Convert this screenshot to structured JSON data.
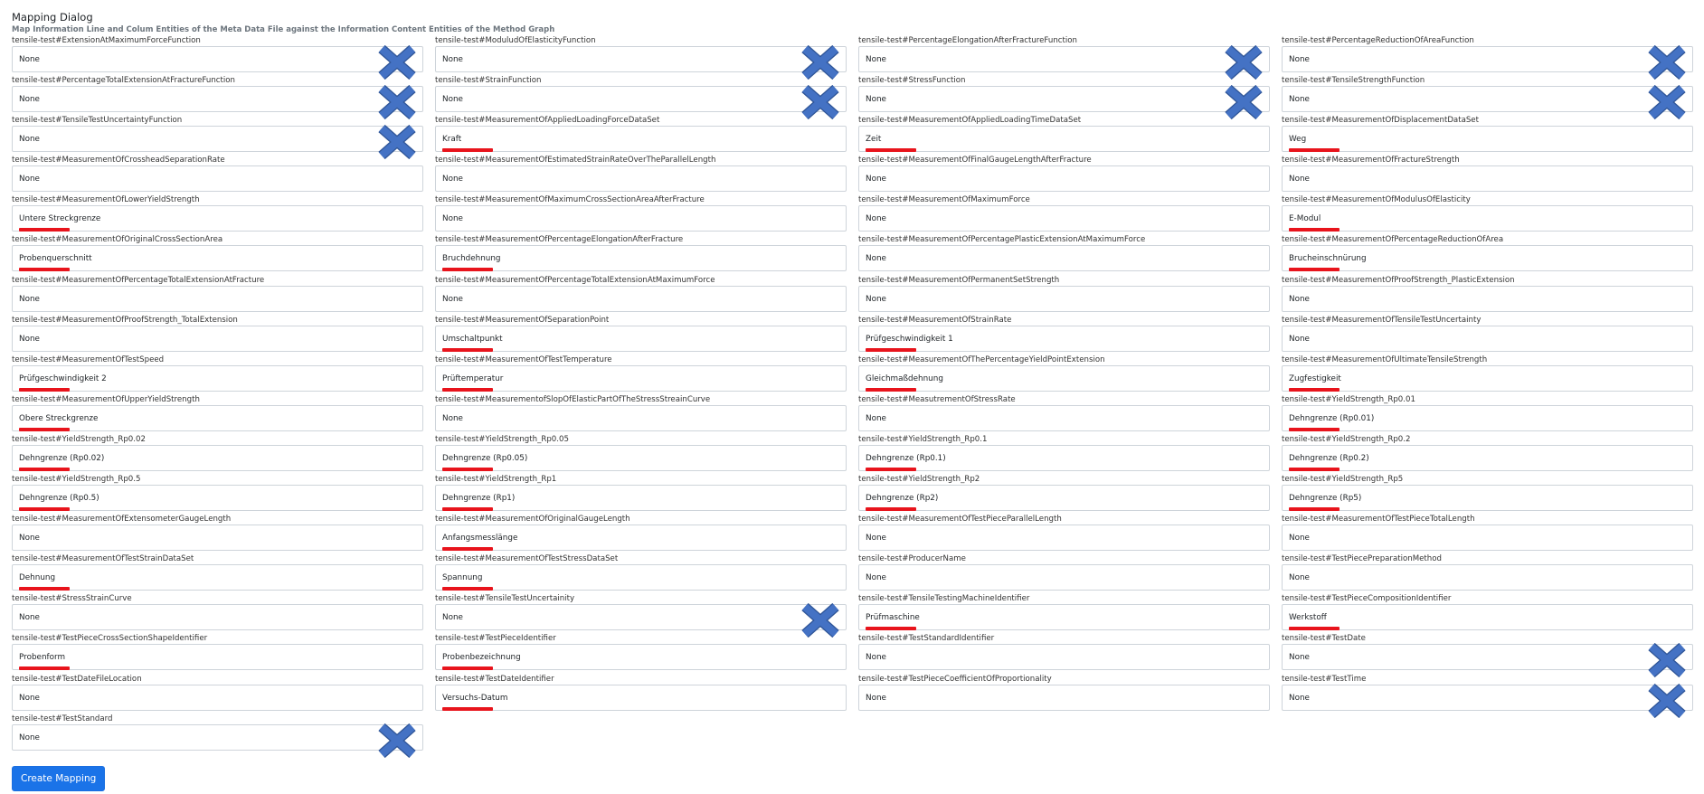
{
  "dialog": {
    "title": "Mapping Dialog",
    "subtitle": "Map Information Line and Colum Entities of the Meta Data File against the Information Content Entities of the Method Graph",
    "create_label": "Create Mapping"
  },
  "colors": {
    "accent": "#1a73e8",
    "underline": "#e8141c",
    "remove_icon": "#4472c4"
  },
  "fields": [
    {
      "label": "tensile-test#ExtensionAtMaximumForceFunction",
      "value": "None",
      "mapped": false,
      "removable": true
    },
    {
      "label": "tensile-test#ModuludOfElasticityFunction",
      "value": "None",
      "mapped": false,
      "removable": true
    },
    {
      "label": "tensile-test#PercentageElongationAfterFractureFunction",
      "value": "None",
      "mapped": false,
      "removable": true
    },
    {
      "label": "tensile-test#PercentageReductionOfAreaFunction",
      "value": "None",
      "mapped": false,
      "removable": true
    },
    {
      "label": "tensile-test#PercentageTotalExtensionAtFractureFunction",
      "value": "None",
      "mapped": false,
      "removable": true
    },
    {
      "label": "tensile-test#StrainFunction",
      "value": "None",
      "mapped": false,
      "removable": true
    },
    {
      "label": "tensile-test#StressFunction",
      "value": "None",
      "mapped": false,
      "removable": true
    },
    {
      "label": "tensile-test#TensileStrengthFunction",
      "value": "None",
      "mapped": false,
      "removable": true
    },
    {
      "label": "tensile-test#TensileTestUncertaintyFunction",
      "value": "None",
      "mapped": false,
      "removable": true
    },
    {
      "label": "tensile-test#MeasurementOfAppliedLoadingForceDataSet",
      "value": "Kraft",
      "mapped": true,
      "removable": false
    },
    {
      "label": "tensile-test#MeasurementOfAppliedLoadingTimeDataSet",
      "value": "Zeit",
      "mapped": true,
      "removable": false
    },
    {
      "label": "tensile-test#MeasurementOfDisplacementDataSet",
      "value": "Weg",
      "mapped": true,
      "removable": false
    },
    {
      "label": "tensile-test#MeasurementOfCrossheadSeparationRate",
      "value": "None",
      "mapped": false,
      "removable": false
    },
    {
      "label": "tensile-test#MeasurementOfEstimatedStrainRateOverTheParallelLength",
      "value": "None",
      "mapped": false,
      "removable": false
    },
    {
      "label": "tensile-test#MeasurementOfFinalGaugeLengthAfterFracture",
      "value": "None",
      "mapped": false,
      "removable": false
    },
    {
      "label": "tensile-test#MeasurementOfFractureStrength",
      "value": "None",
      "mapped": false,
      "removable": false
    },
    {
      "label": "tensile-test#MeasurementOfLowerYieldStrength",
      "value": "Untere Streckgrenze",
      "mapped": true,
      "removable": false
    },
    {
      "label": "tensile-test#MeasurementOfMaximumCrossSectionAreaAfterFracture",
      "value": "None",
      "mapped": false,
      "removable": false
    },
    {
      "label": "tensile-test#MeasurementOfMaximumForce",
      "value": "None",
      "mapped": false,
      "removable": false
    },
    {
      "label": "tensile-test#MeasurementOfModulusOfElasticity",
      "value": "E-Modul",
      "mapped": true,
      "removable": false
    },
    {
      "label": "tensile-test#MeasurementOfOriginalCrossSectionArea",
      "value": "Probenquerschnitt",
      "mapped": true,
      "removable": false
    },
    {
      "label": "tensile-test#MeasurementOfPercentageElongationAfterFracture",
      "value": "Bruchdehnung",
      "mapped": true,
      "removable": false
    },
    {
      "label": "tensile-test#MeasurementOfPercentagePlasticExtensionAtMaximumForce",
      "value": "None",
      "mapped": false,
      "removable": false
    },
    {
      "label": "tensile-test#MeasurementOfPercentageReductionOfArea",
      "value": "Brucheinschnürung",
      "mapped": true,
      "removable": false
    },
    {
      "label": "tensile-test#MeasurementOfPercentageTotalExtensionAtFracture",
      "value": "None",
      "mapped": false,
      "removable": false
    },
    {
      "label": "tensile-test#MeasurementOfPercentageTotalExtensionAtMaximumForce",
      "value": "None",
      "mapped": false,
      "removable": false
    },
    {
      "label": "tensile-test#MeasurementOfPermanentSetStrength",
      "value": "None",
      "mapped": false,
      "removable": false
    },
    {
      "label": "tensile-test#MeasurementOfProofStrength_PlasticExtension",
      "value": "None",
      "mapped": false,
      "removable": false
    },
    {
      "label": "tensile-test#MeasurementOfProofStrength_TotalExtension",
      "value": "None",
      "mapped": false,
      "removable": false
    },
    {
      "label": "tensile-test#MeasurementOfSeparationPoint",
      "value": "Umschaltpunkt",
      "mapped": true,
      "removable": false
    },
    {
      "label": "tensile-test#MeasurementOfStrainRate",
      "value": "Prüfgeschwindigkeit 1",
      "mapped": true,
      "removable": false
    },
    {
      "label": "tensile-test#MeasurementOfTensileTestUncertainty",
      "value": "None",
      "mapped": false,
      "removable": false
    },
    {
      "label": "tensile-test#MeasurementOfTestSpeed",
      "value": "Prüfgeschwindigkeit 2",
      "mapped": true,
      "removable": false
    },
    {
      "label": "tensile-test#MeasurementOfTestTemperature",
      "value": "Prüftemperatur",
      "mapped": true,
      "removable": false
    },
    {
      "label": "tensile-test#MeasurementOfThePercentageYieldPointExtension",
      "value": "Gleichmaßdehnung",
      "mapped": true,
      "removable": false
    },
    {
      "label": "tensile-test#MeasurementOfUltimateTensileStrength",
      "value": "Zugfestigkeit",
      "mapped": true,
      "removable": false
    },
    {
      "label": "tensile-test#MeasurementOfUpperYieldStrength",
      "value": "Obere Streckgrenze",
      "mapped": true,
      "removable": false
    },
    {
      "label": "tensile-test#MeasurementofSlopOfElasticPartOfTheStressStreainCurve",
      "value": "None",
      "mapped": false,
      "removable": false
    },
    {
      "label": "tensile-test#MeasutrementOfStressRate",
      "value": "None",
      "mapped": false,
      "removable": false
    },
    {
      "label": "tensile-test#YieldStrength_Rp0.01",
      "value": "Dehngrenze (Rp0.01)",
      "mapped": true,
      "removable": false
    },
    {
      "label": "tensile-test#YieldStrength_Rp0.02",
      "value": "Dehngrenze (Rp0.02)",
      "mapped": true,
      "removable": false
    },
    {
      "label": "tensile-test#YieldStrength_Rp0.05",
      "value": "Dehngrenze (Rp0.05)",
      "mapped": true,
      "removable": false
    },
    {
      "label": "tensile-test#YieldStrength_Rp0.1",
      "value": "Dehngrenze (Rp0.1)",
      "mapped": true,
      "removable": false
    },
    {
      "label": "tensile-test#YieldStrength_Rp0.2",
      "value": "Dehngrenze (Rp0.2)",
      "mapped": true,
      "removable": false
    },
    {
      "label": "tensile-test#YieldStrength_Rp0.5",
      "value": "Dehngrenze (Rp0.5)",
      "mapped": true,
      "removable": false
    },
    {
      "label": "tensile-test#YieldStrength_Rp1",
      "value": "Dehngrenze (Rp1)",
      "mapped": true,
      "removable": false
    },
    {
      "label": "tensile-test#YieldStrength_Rp2",
      "value": "Dehngrenze (Rp2)",
      "mapped": true,
      "removable": false
    },
    {
      "label": "tensile-test#YieldStrength_Rp5",
      "value": "Dehngrenze (Rp5)",
      "mapped": true,
      "removable": false
    },
    {
      "label": "tensile-test#MeasurementOfExtensometerGaugeLength",
      "value": "None",
      "mapped": false,
      "removable": false
    },
    {
      "label": "tensile-test#MeasurementOfOriginalGaugeLength",
      "value": "Anfangsmesslänge",
      "mapped": true,
      "removable": false
    },
    {
      "label": "tensile-test#MeasurementOfTestPieceParallelLength",
      "value": "None",
      "mapped": false,
      "removable": false
    },
    {
      "label": "tensile-test#MeasurementOfTestPieceTotalLength",
      "value": "None",
      "mapped": false,
      "removable": false
    },
    {
      "label": "tensile-test#MeasurementOfTestStrainDataSet",
      "value": "Dehnung",
      "mapped": true,
      "removable": false
    },
    {
      "label": "tensile-test#MeasurementOfTestStressDataSet",
      "value": "Spannung",
      "mapped": true,
      "removable": false
    },
    {
      "label": "tensile-test#ProducerName",
      "value": "None",
      "mapped": false,
      "removable": false
    },
    {
      "label": "tensile-test#TestPiecePreparationMethod",
      "value": "None",
      "mapped": false,
      "removable": false
    },
    {
      "label": "tensile-test#StressStrainCurve",
      "value": "None",
      "mapped": false,
      "removable": false
    },
    {
      "label": "tensile-test#TensileTestUncertainity",
      "value": "None",
      "mapped": false,
      "removable": true
    },
    {
      "label": "tensile-test#TensileTestingMachineIdentifier",
      "value": "Prüfmaschine",
      "mapped": true,
      "removable": false
    },
    {
      "label": "tensile-test#TestPieceCompositionIdentifier",
      "value": "Werkstoff",
      "mapped": true,
      "removable": false
    },
    {
      "label": "tensile-test#TestPieceCrossSectionShapeIdentifier",
      "value": "Probenform",
      "mapped": true,
      "removable": false
    },
    {
      "label": "tensile-test#TestPieceIdentifier",
      "value": "Probenbezeichnung",
      "mapped": true,
      "removable": false
    },
    {
      "label": "tensile-test#TestStandardIdentifier",
      "value": "None",
      "mapped": false,
      "removable": false
    },
    {
      "label": "tensile-test#TestDate",
      "value": "None",
      "mapped": false,
      "removable": true
    },
    {
      "label": "tensile-test#TestDateFileLocation",
      "value": "None",
      "mapped": false,
      "removable": false
    },
    {
      "label": "tensile-test#TestDateIdentifier",
      "value": "Versuchs-Datum",
      "mapped": true,
      "removable": false
    },
    {
      "label": "tensile-test#TestPieceCoefficientOfProportionality",
      "value": "None",
      "mapped": false,
      "removable": false
    },
    {
      "label": "tensile-test#TestTime",
      "value": "None",
      "mapped": false,
      "removable": true
    },
    {
      "label": "tensile-test#TestStandard",
      "value": "None",
      "mapped": false,
      "removable": true
    }
  ]
}
